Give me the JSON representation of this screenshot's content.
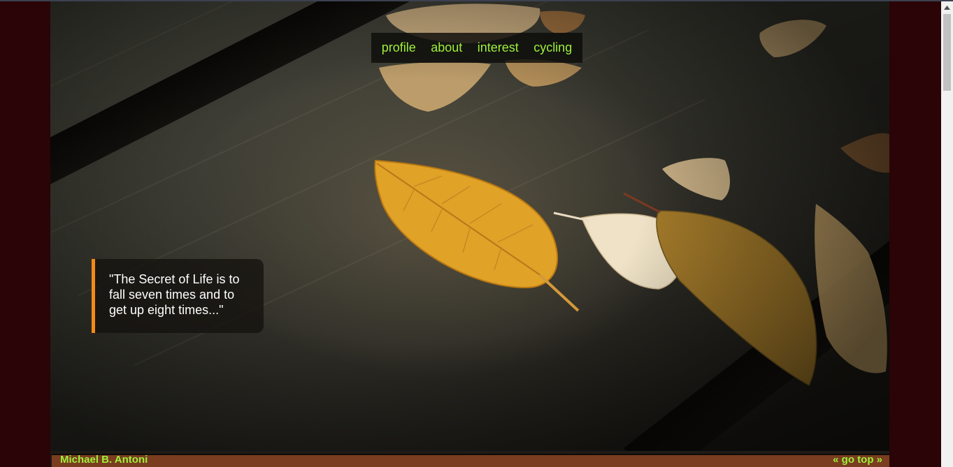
{
  "nav": {
    "items": [
      {
        "label": "profile"
      },
      {
        "label": "about"
      },
      {
        "label": "interest"
      },
      {
        "label": "cycling"
      }
    ]
  },
  "quote": {
    "text": "\"The Secret of Life is to fall seven times and to get up eight times...\""
  },
  "footer": {
    "name": "Michael B. Antoni",
    "go_top": "« go top »"
  },
  "colors": {
    "accent": "#9ef03a",
    "quote_border": "#f28a17",
    "footer_bg": "#7a3d1f",
    "page_margin_bg": "#2a0407"
  },
  "hero": {
    "description_icon": "autumn-leaves-image"
  }
}
